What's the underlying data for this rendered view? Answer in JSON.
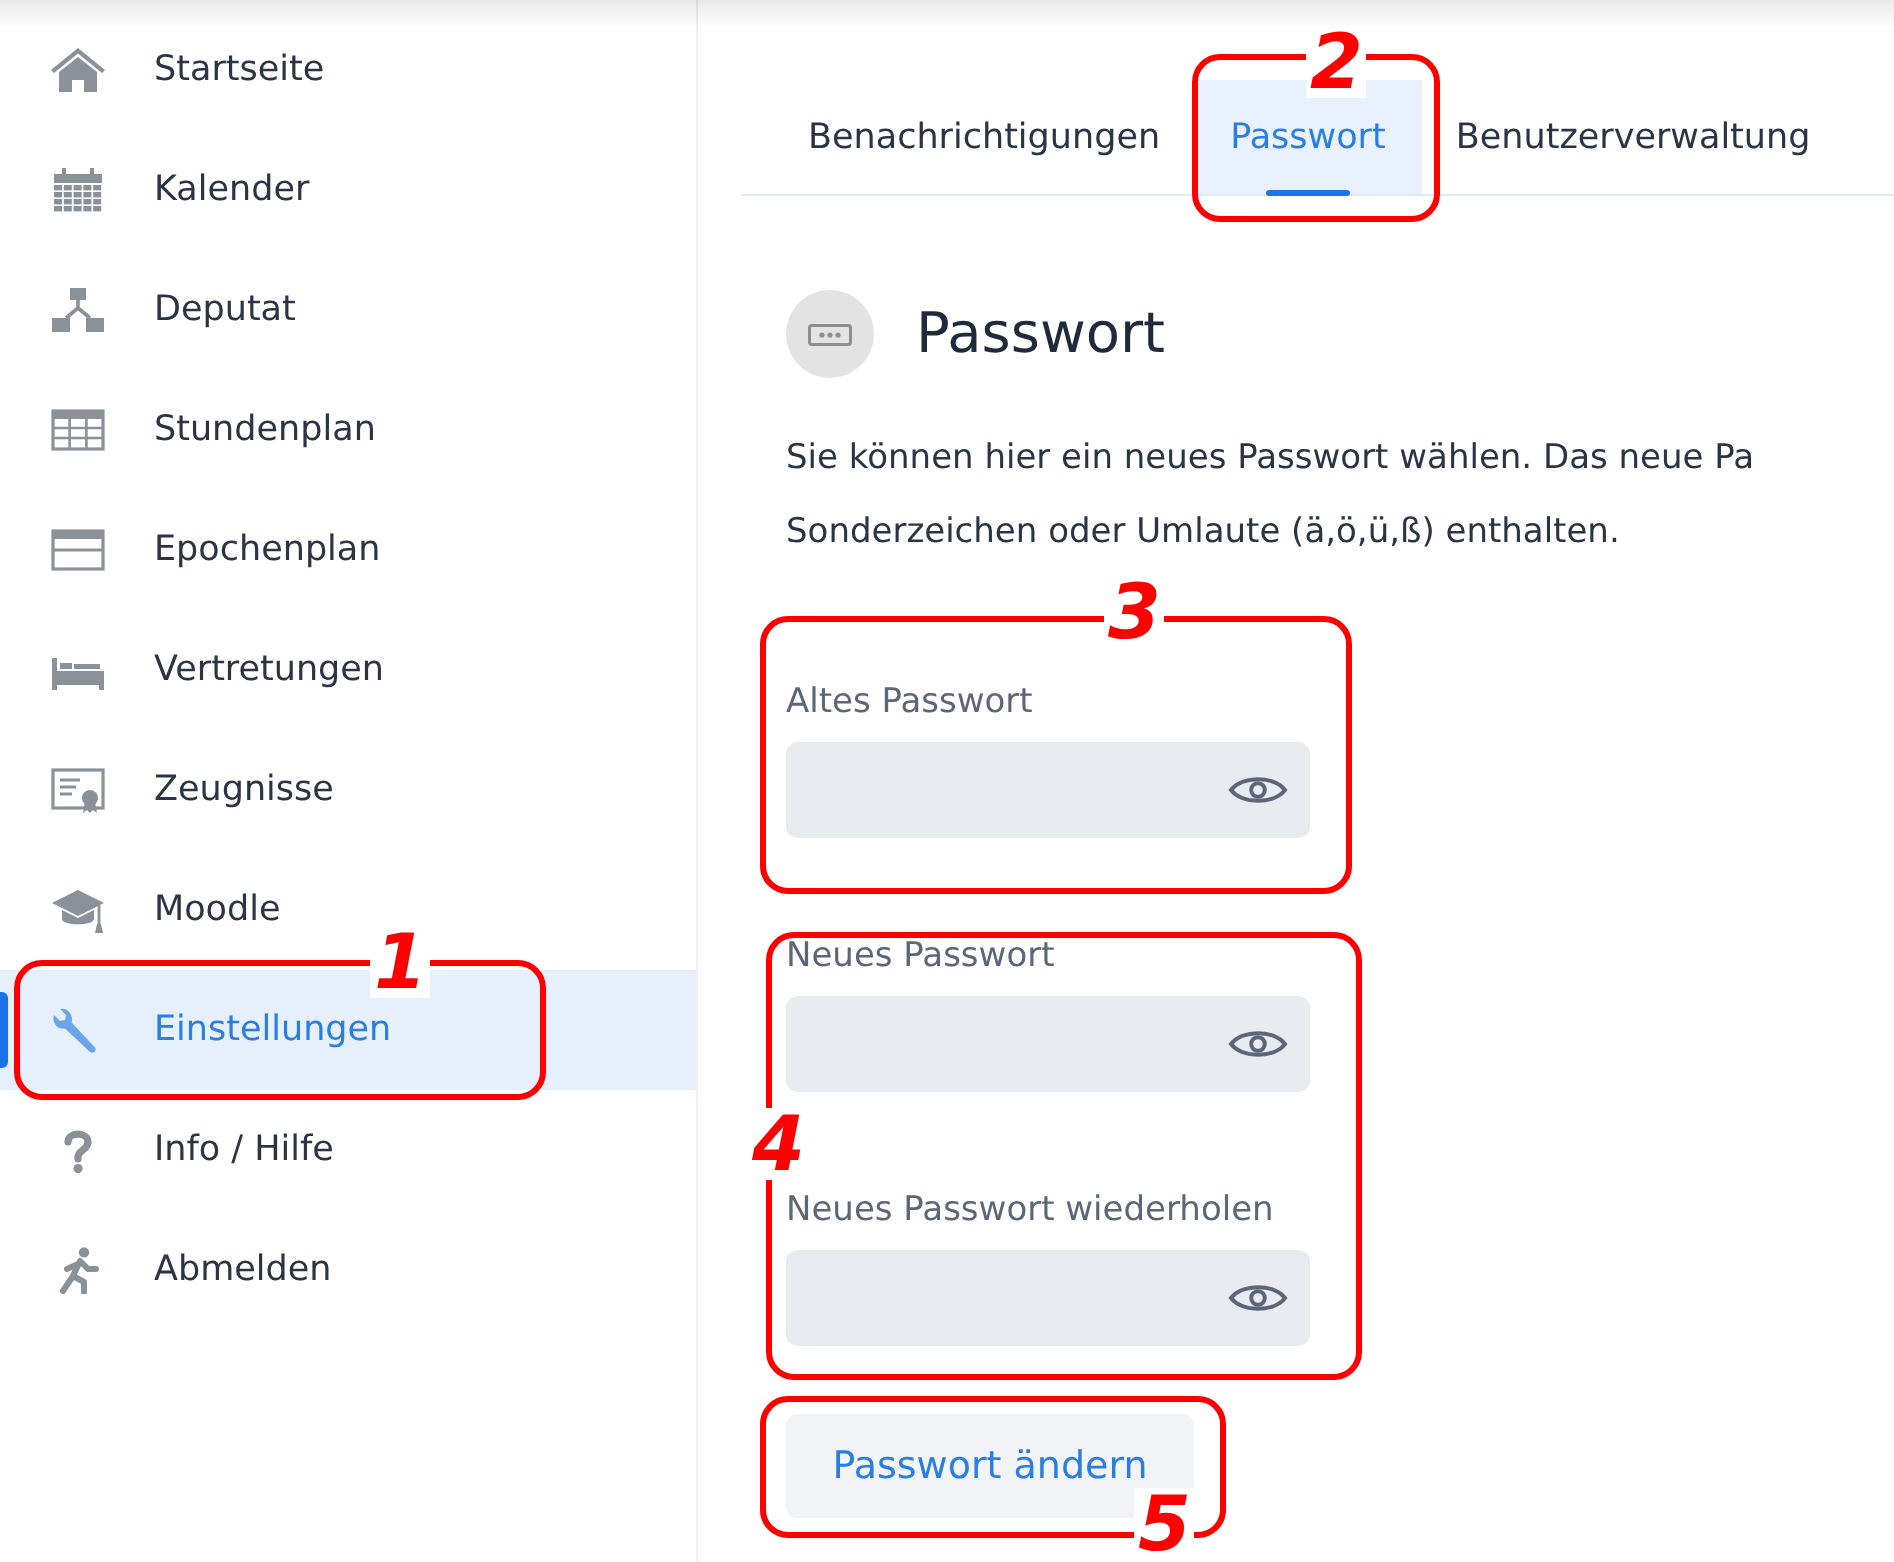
{
  "sidebar": {
    "items": [
      {
        "label": "Startseite",
        "selected": false
      },
      {
        "label": "Kalender",
        "selected": false
      },
      {
        "label": "Deputat",
        "selected": false
      },
      {
        "label": "Stundenplan",
        "selected": false
      },
      {
        "label": "Epochenplan",
        "selected": false
      },
      {
        "label": "Vertretungen",
        "selected": false
      },
      {
        "label": "Zeugnisse",
        "selected": false
      },
      {
        "label": "Moodle",
        "selected": false
      },
      {
        "label": "Einstellungen",
        "selected": true
      },
      {
        "label": "Info / Hilfe",
        "selected": false
      },
      {
        "label": "Abmelden",
        "selected": false
      }
    ]
  },
  "tabs": [
    {
      "label": "Benachrichtigungen",
      "selected": false
    },
    {
      "label": "Passwort",
      "selected": true
    },
    {
      "label": "Benutzerverwaltung",
      "selected": false
    }
  ],
  "section": {
    "title": "Passwort",
    "description_lines": [
      "Sie können hier ein neues Passwort wählen. Das neue Pa",
      "Sonderzeichen oder Umlaute (ä,ö,ü,ß) enthalten."
    ]
  },
  "fields": [
    {
      "label": "Altes Passwort"
    },
    {
      "label": "Neues Passwort"
    },
    {
      "label": "Neues Passwort wiederholen"
    }
  ],
  "submit_button": {
    "label": "Passwort ändern"
  },
  "annotations": [
    {
      "label": "1"
    },
    {
      "label": "2"
    },
    {
      "label": "3"
    },
    {
      "label": "4"
    },
    {
      "label": "5"
    }
  ]
}
